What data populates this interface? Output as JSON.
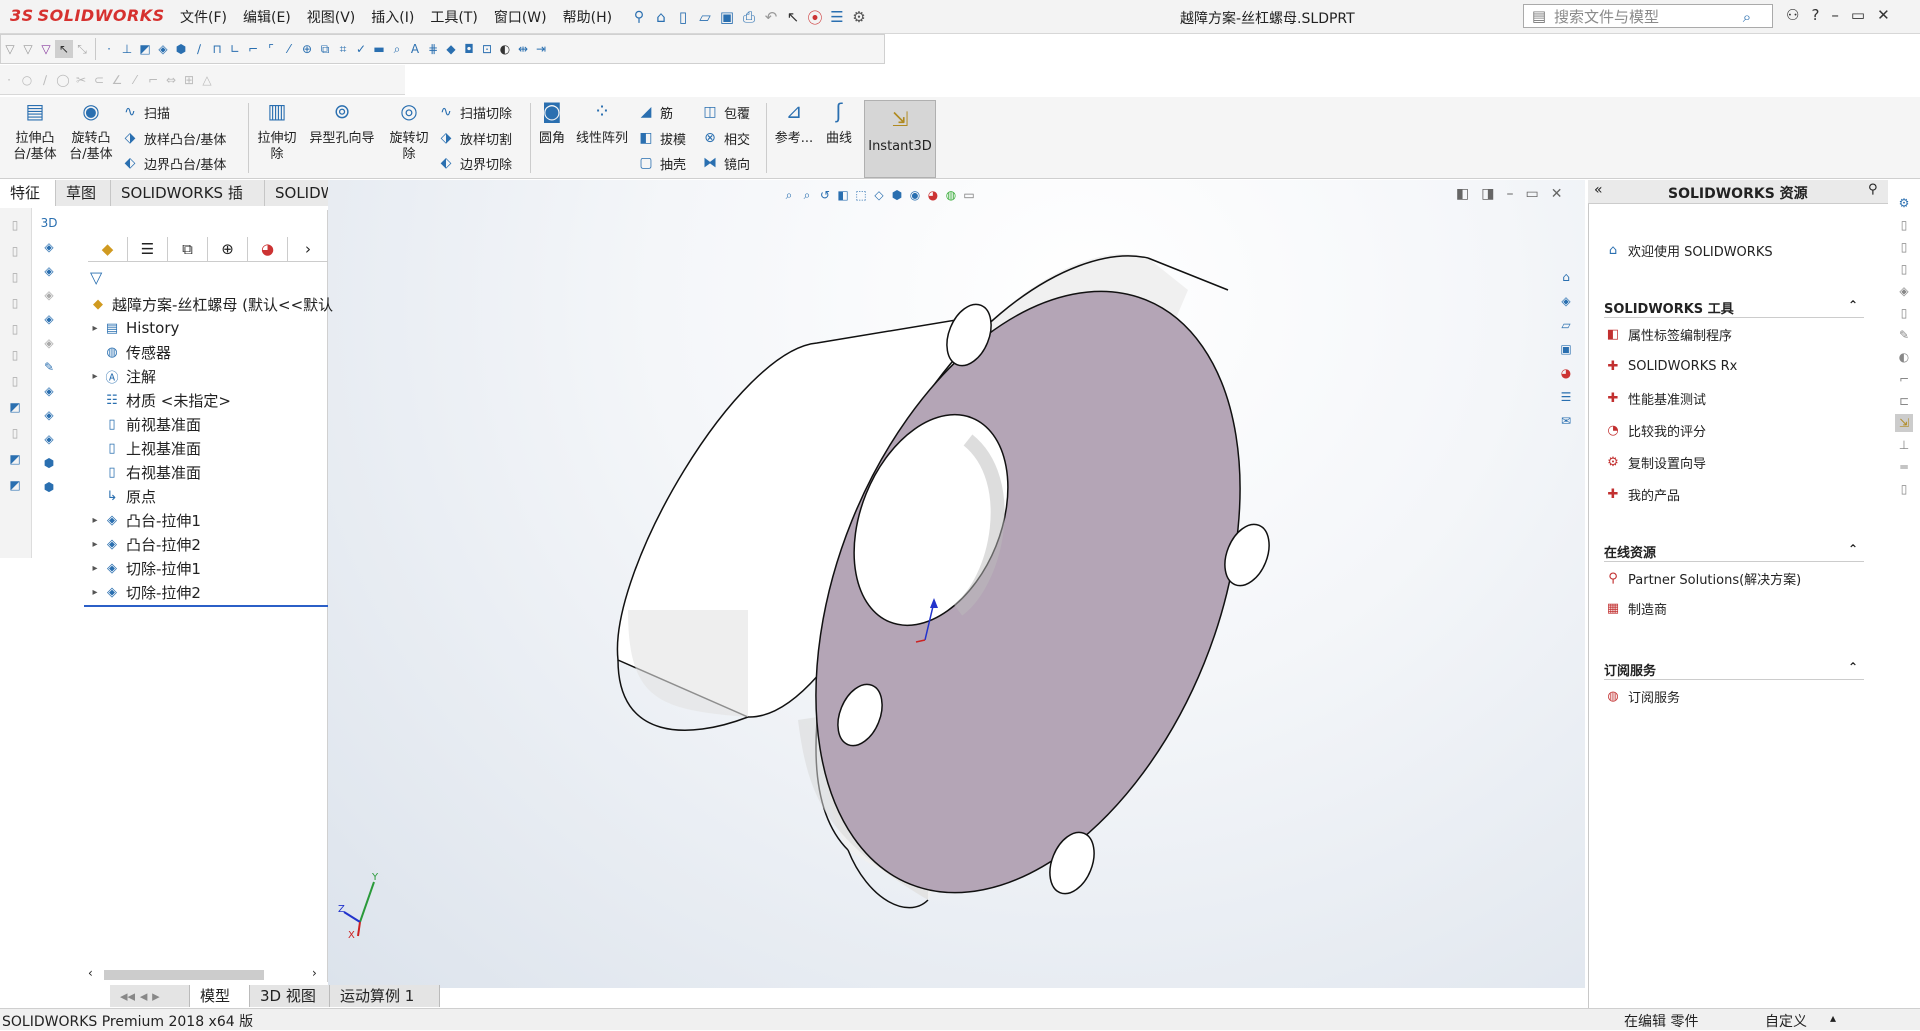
{
  "app": {
    "logo_ds": "3S",
    "logo_text": "SOLIDWORKS",
    "title": "越障方案-丝杠螺母.SLDPRT"
  },
  "menu": [
    "文件(F)",
    "编辑(E)",
    "视图(V)",
    "插入(I)",
    "工具(T)",
    "窗口(W)",
    "帮助(H)"
  ],
  "search": {
    "placeholder": "搜索文件与模型"
  },
  "window_controls": {
    "help": "?",
    "minimize": "–",
    "restore": "▭",
    "close": "✕"
  },
  "command_manager": {
    "extrude_boss": "拉伸凸\n台/基体",
    "revolve_boss": "旋转凸\n台/基体",
    "sweep": "扫描",
    "loft_boss": "放样凸台/基体",
    "boundary_boss": "边界凸台/基体",
    "extrude_cut": "拉伸切\n除",
    "hole_wizard": "异型孔向导",
    "revolve_cut": "旋转切\n除",
    "sweep_cut": "扫描切除",
    "loft_cut": "放样切割",
    "boundary_cut": "边界切除",
    "fillet": "圆角",
    "linear_pattern": "线性阵列",
    "rib": "筋",
    "draft": "拔模",
    "shell": "抽壳",
    "wrap": "包覆",
    "intersect": "相交",
    "mirror": "镜向",
    "reference": "参考...",
    "curves": "曲线",
    "instant3d": "Instant3D"
  },
  "tabs": [
    "特征",
    "草图",
    "SOLIDWORKS 插件",
    "SOLIDWORKS MBD"
  ],
  "feature_tree": {
    "root": "越障方案-丝杠螺母 (默认<<默认",
    "items": [
      {
        "label": "History",
        "expand": "▸"
      },
      {
        "label": "传感器",
        "expand": ""
      },
      {
        "label": "注解",
        "expand": "▸"
      },
      {
        "label": "材质 <未指定>",
        "expand": ""
      },
      {
        "label": "前视基准面",
        "expand": ""
      },
      {
        "label": "上视基准面",
        "expand": ""
      },
      {
        "label": "右视基准面",
        "expand": ""
      },
      {
        "label": "原点",
        "expand": ""
      },
      {
        "label": "凸台-拉伸1",
        "expand": "▸"
      },
      {
        "label": "凸台-拉伸2",
        "expand": "▸"
      },
      {
        "label": "切除-拉伸1",
        "expand": "▸"
      },
      {
        "label": "切除-拉伸2",
        "expand": "▸"
      }
    ]
  },
  "bottom_tabs": [
    "模型",
    "3D 视图",
    "运动算例 1"
  ],
  "task_pane": {
    "title": "SOLIDWORKS 资源",
    "welcome": "欢迎使用 SOLIDWORKS",
    "sections": [
      {
        "title": "SOLIDWORKS 工具",
        "items": [
          "属性标签编制程序",
          "SOLIDWORKS Rx",
          "性能基准测试",
          "比较我的评分",
          "复制设置向导",
          "我的产品"
        ]
      },
      {
        "title": "在线资源",
        "items": [
          "Partner Solutions(解决方案)",
          "制造商"
        ]
      },
      {
        "title": "订阅服务",
        "items": [
          "订阅服务"
        ]
      }
    ]
  },
  "status": {
    "left": "SOLIDWORKS Premium 2018 x64 版",
    "mode": "在编辑 零件",
    "custom": "自定义"
  },
  "triad": {
    "x": "X",
    "y": "Y",
    "z": "Z"
  },
  "colors": {
    "face": "#b4a5b6",
    "accent": "#2a6fb0",
    "brand": "#d6312f"
  }
}
